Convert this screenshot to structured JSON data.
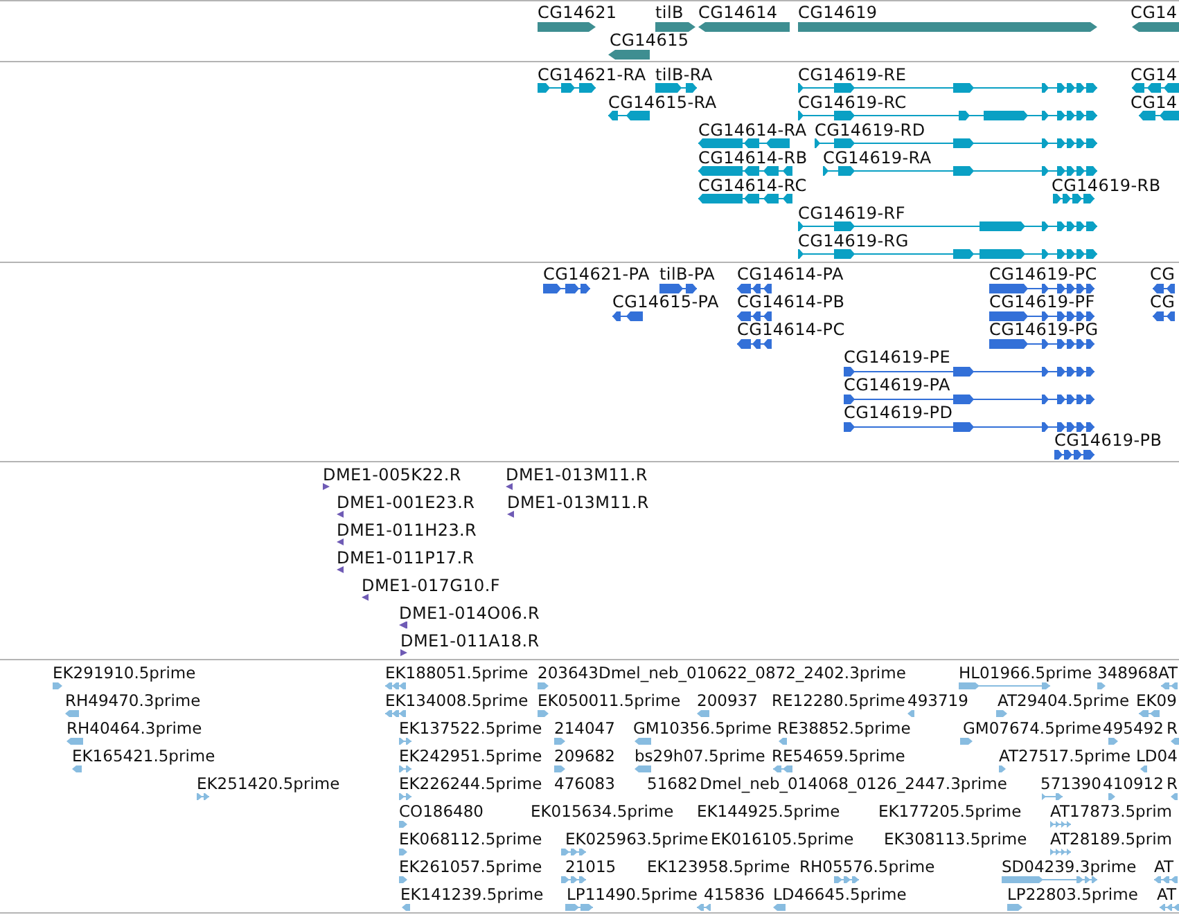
{
  "tracks": [
    {
      "kind": "gene",
      "features": [
        {
          "label": "CG14621",
          "reverse": false
        },
        {
          "label": "tilB",
          "reverse": false
        },
        {
          "label": "CG14614",
          "reverse": true
        },
        {
          "label": "CG14619",
          "reverse": false
        },
        {
          "label": "CG14",
          "reverse": true
        },
        {
          "label": "CG14615",
          "reverse": true
        }
      ]
    },
    {
      "kind": "transcript",
      "features": [
        {
          "label": "CG14621-RA",
          "reverse": false
        },
        {
          "label": "tilB-RA",
          "reverse": false
        },
        {
          "label": "CG14619-RE",
          "reverse": false
        },
        {
          "label": "CG14",
          "reverse": true
        },
        {
          "label": "CG14615-RA",
          "reverse": true
        },
        {
          "label": "CG14619-RC",
          "reverse": false
        },
        {
          "label": "CG14",
          "reverse": true
        },
        {
          "label": "CG14614-RA",
          "reverse": true
        },
        {
          "label": "CG14619-RD",
          "reverse": false
        },
        {
          "label": "CG14614-RB",
          "reverse": true
        },
        {
          "label": "CG14619-RA",
          "reverse": false
        },
        {
          "label": "CG14614-RC",
          "reverse": true
        },
        {
          "label": "CG14619-RB",
          "reverse": false
        },
        {
          "label": "CG14619-RF",
          "reverse": false
        },
        {
          "label": "CG14619-RG",
          "reverse": false
        }
      ]
    },
    {
      "kind": "protein",
      "features": [
        {
          "label": "CG14621-PA",
          "reverse": false
        },
        {
          "label": "tilB-PA",
          "reverse": false
        },
        {
          "label": "CG14614-PA",
          "reverse": true
        },
        {
          "label": "CG14619-PC",
          "reverse": false
        },
        {
          "label": "CG",
          "reverse": true
        },
        {
          "label": "CG14615-PA",
          "reverse": true
        },
        {
          "label": "CG14614-PB",
          "reverse": true
        },
        {
          "label": "CG14619-PF",
          "reverse": false
        },
        {
          "label": "CG",
          "reverse": true
        },
        {
          "label": "CG14614-PC",
          "reverse": true
        },
        {
          "label": "CG14619-PG",
          "reverse": false
        },
        {
          "label": "CG14619-PE",
          "reverse": false
        },
        {
          "label": "CG14619-PA",
          "reverse": false
        },
        {
          "label": "CG14619-PD",
          "reverse": false
        },
        {
          "label": "CG14619-PB",
          "reverse": false
        }
      ]
    },
    {
      "kind": "clone",
      "features": [
        {
          "label": "DME1-005K22.R",
          "reverse": false
        },
        {
          "label": "DME1-013M11.R",
          "reverse": true
        },
        {
          "label": "DME1-001E23.R",
          "reverse": true
        },
        {
          "label": "DME1-013M11.R",
          "reverse": true
        },
        {
          "label": "DME1-011H23.R",
          "reverse": true
        },
        {
          "label": "DME1-011P17.R",
          "reverse": true
        },
        {
          "label": "DME1-017G10.F",
          "reverse": true
        },
        {
          "label": "DME1-014O06.R",
          "reverse": true
        },
        {
          "label": "DME1-011A18.R",
          "reverse": false
        }
      ]
    },
    {
      "kind": "est",
      "features": [
        {
          "label": "EK291910.5prime",
          "reverse": false
        },
        {
          "label": "EK188051.5prime",
          "reverse": true
        },
        {
          "label": "203643",
          "reverse": false
        },
        {
          "label": "Dmel_neb_010622_0872_2402.3prime"
        },
        {
          "label": "HL01966.5prime",
          "reverse": false
        },
        {
          "label": "348968",
          "reverse": false
        },
        {
          "label": "AT",
          "reverse": true
        },
        {
          "label": "RH49470.3prime",
          "reverse": true
        },
        {
          "label": "EK134008.5prime",
          "reverse": true
        },
        {
          "label": "EK050011.5prime",
          "reverse": false
        },
        {
          "label": "200937",
          "reverse": true
        },
        {
          "label": "RE12280.5prime"
        },
        {
          "label": "493719",
          "reverse": true
        },
        {
          "label": "AT29404.5prime",
          "reverse": false
        },
        {
          "label": "EK09",
          "reverse": true
        },
        {
          "label": "RH40464.3prime",
          "reverse": true
        },
        {
          "label": "EK137522.5prime",
          "reverse": false
        },
        {
          "label": "214047",
          "reverse": false
        },
        {
          "label": "GM10356.5prime",
          "reverse": true
        },
        {
          "label": "RE38852.5prime",
          "reverse": true
        },
        {
          "label": "GM07674.5prime",
          "reverse": false
        },
        {
          "label": "495492",
          "reverse": false
        },
        {
          "label": "R",
          "reverse": true
        },
        {
          "label": "EK165421.5prime",
          "reverse": true
        },
        {
          "label": "EK242951.5prime",
          "reverse": false
        },
        {
          "label": "209682",
          "reverse": false
        },
        {
          "label": "bs29h07.5prime",
          "reverse": true
        },
        {
          "label": "RE54659.5prime",
          "reverse": true
        },
        {
          "label": "AT27517.5prime",
          "reverse": false
        },
        {
          "label": "LD04",
          "reverse": true
        },
        {
          "label": "EK251420.5prime",
          "reverse": false
        },
        {
          "label": "EK226244.5prime",
          "reverse": false
        },
        {
          "label": "476083"
        },
        {
          "label": "51682"
        },
        {
          "label": "Dmel_neb_014068_0126_2447.3prime"
        },
        {
          "label": "571390",
          "reverse": false
        },
        {
          "label": "410912",
          "reverse": false
        },
        {
          "label": "R",
          "reverse": true
        },
        {
          "label": "CO186480",
          "reverse": false
        },
        {
          "label": "EK015634.5prime"
        },
        {
          "label": "EK144925.5prime"
        },
        {
          "label": "EK177205.5prime"
        },
        {
          "label": "AT17873.5prim",
          "reverse": false
        },
        {
          "label": "EK068112.5prime",
          "reverse": false
        },
        {
          "label": "EK025963.5prime",
          "reverse": false
        },
        {
          "label": "EK016105.5prime"
        },
        {
          "label": "EK308113.5prime"
        },
        {
          "label": "AT28189.5prim",
          "reverse": false
        },
        {
          "label": "EK261057.5prime",
          "reverse": false
        },
        {
          "label": "21015",
          "reverse": false
        },
        {
          "label": "EK123958.5prime"
        },
        {
          "label": "RH05576.5prime",
          "reverse": false
        },
        {
          "label": "SD04239.3prime",
          "reverse": false
        },
        {
          "label": "AT",
          "reverse": true
        },
        {
          "label": "EK141239.5prime",
          "reverse": true
        },
        {
          "label": "LP11490.5prime",
          "reverse": false
        },
        {
          "label": "415836",
          "reverse": true
        },
        {
          "label": "LD46645.5prime",
          "reverse": true
        },
        {
          "label": "LP22803.5prime",
          "reverse": false
        },
        {
          "label": "AT",
          "reverse": true
        }
      ]
    }
  ]
}
